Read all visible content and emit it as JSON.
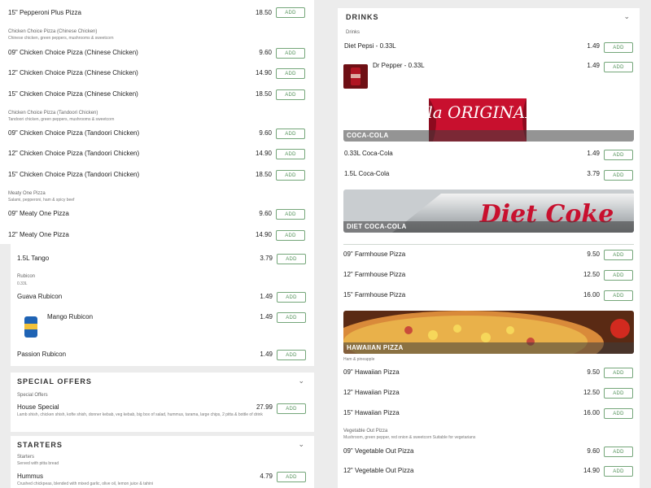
{
  "tl": {
    "items": [
      {
        "name": "15\" Pepperoni Plus Pizza",
        "price": "18.50"
      },
      {
        "name": "09\" Chicken Choice Pizza (Chinese Chicken)",
        "price": "9.60"
      },
      {
        "name": "12\" Chicken Choice Pizza (Chinese Chicken)",
        "price": "14.90"
      },
      {
        "name": "15\" Chicken Choice Pizza (Chinese Chicken)",
        "price": "18.50"
      },
      {
        "name": "09\" Chicken Choice Pizza (Tandoori Chicken)",
        "price": "9.60"
      },
      {
        "name": "12\" Chicken Choice Pizza (Tandoori Chicken)",
        "price": "14.90"
      },
      {
        "name": "15\" Chicken Choice Pizza (Tandoori Chicken)",
        "price": "18.50"
      },
      {
        "name": "09\" Meaty One Pizza",
        "price": "9.60"
      },
      {
        "name": "12\" Meaty One Pizza",
        "price": "14.90"
      }
    ],
    "cats": [
      {
        "title": "Chicken Choice Pizza (Chinese Chicken)",
        "desc": "Chinese chicken, green peppers, mushrooms & sweetcorn"
      },
      {
        "title": "Chicken Choice Pizza (Tandoori Chicken)",
        "desc": "Tandoori chicken, green peppers, mushrooms & sweetcorn"
      },
      {
        "title": "Meaty One Pizza",
        "desc": "Salami, pepperoni, ham & spicy beef"
      }
    ]
  },
  "tr": {
    "section_title": "DRINKS",
    "subtitle": "Drinks",
    "items": [
      {
        "name": "Diet Pepsi - 0.33L",
        "price": "1.49"
      },
      {
        "name": "Dr Pepper - 0.33L",
        "price": "1.49"
      },
      {
        "name": "0.33L Coca-Cola",
        "price": "1.49"
      },
      {
        "name": "1.5L Coca-Cola",
        "price": "3.79"
      }
    ],
    "banners": [
      {
        "label": "COCA-COLA",
        "image_text": "Coca-Cola ORIGINAL TASTE"
      },
      {
        "label": "DIET COCA-COLA",
        "image_text": "Diet Coke"
      }
    ]
  },
  "bl": {
    "items": [
      {
        "name": "1.5L Tango",
        "price": "3.79"
      },
      {
        "name": "Guava Rubicon",
        "price": "1.49"
      },
      {
        "name": "Mango Rubicon",
        "price": "1.49"
      },
      {
        "name": "Passion Rubicon",
        "price": "1.49"
      }
    ],
    "rubicon": {
      "title": "Rubicon",
      "desc": "0.33L"
    },
    "special": {
      "title": "SPECIAL OFFERS",
      "subtitle": "Special Offers",
      "item": {
        "name": "House Special",
        "price": "27.99",
        "desc": "Lamb shish, chicken shish, kofte shish, donner kebab, veg kebab, big box of salad, hummus, tarama, large chips, 2 pitta & bottle of drink"
      }
    },
    "starters": {
      "title": "STARTERS",
      "subtitle": "Starters",
      "subdesc": "Served with pitta bread",
      "item": {
        "name": "Hummus",
        "price": "4.79",
        "desc": "Crushed chickpeas, blended with mixed garlic, olive oil, lemon juice & tahini"
      }
    }
  },
  "br": {
    "items": [
      {
        "name": "09\" Farmhouse Pizza",
        "price": "9.50"
      },
      {
        "name": "12\" Farmhouse Pizza",
        "price": "12.50"
      },
      {
        "name": "15\" Farmhouse Pizza",
        "price": "16.00"
      },
      {
        "name": "09\" Hawaiian Pizza",
        "price": "9.50"
      },
      {
        "name": "12\" Hawaiian Pizza",
        "price": "12.50"
      },
      {
        "name": "15\" Hawaiian Pizza",
        "price": "16.00"
      },
      {
        "name": "09\" Vegetable Out Pizza",
        "price": "9.60"
      },
      {
        "name": "12\" Vegetable Out Pizza",
        "price": "14.90"
      }
    ],
    "hawaiian_banner": "HAWAIIAN PIZZA",
    "hawaiian_desc": "Ham & pineapple",
    "veg": {
      "title": "Vegetable Out Pizza",
      "desc": "Mushroom, green pepper, red onion & sweetcorn Suitable for vegetarians"
    }
  },
  "add_label": "ADD",
  "chevron": "⌄",
  "colors": {
    "accent": "#4e8f55",
    "coke_red": "#c8102e"
  }
}
